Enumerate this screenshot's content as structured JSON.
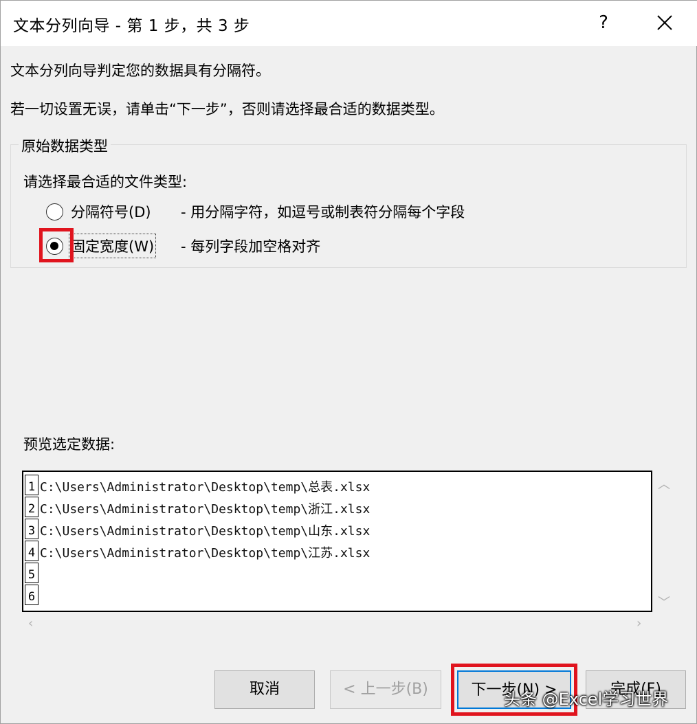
{
  "window": {
    "title": "文本分列向导 - 第 1 步，共 3 步",
    "help_label": "?"
  },
  "instructions": {
    "line1": "文本分列向导判定您的数据具有分隔符。",
    "line2": "若一切设置无误，请单击“下一步”，否则请选择最合适的数据类型。"
  },
  "original_type_group": {
    "title": "原始数据类型",
    "prompt": "请选择最合适的文件类型:",
    "options": [
      {
        "label": "分隔符号(D)",
        "description": "- 用分隔字符，如逗号或制表符分隔每个字段",
        "selected": false
      },
      {
        "label": "固定宽度(W)",
        "description": "- 每列字段加空格对齐",
        "selected": true
      }
    ]
  },
  "preview": {
    "label": "预览选定数据:",
    "rows": [
      {
        "num": "1",
        "text": "C:\\Users\\Administrator\\Desktop\\temp\\总表.xlsx"
      },
      {
        "num": "2",
        "text": "C:\\Users\\Administrator\\Desktop\\temp\\浙江.xlsx"
      },
      {
        "num": "3",
        "text": "C:\\Users\\Administrator\\Desktop\\temp\\山东.xlsx"
      },
      {
        "num": "4",
        "text": "C:\\Users\\Administrator\\Desktop\\temp\\江苏.xlsx"
      },
      {
        "num": "5",
        "text": ""
      },
      {
        "num": "6",
        "text": ""
      }
    ]
  },
  "buttons": {
    "cancel": "取消",
    "back": "< 上一步(B)",
    "next": "下一步(N) >",
    "finish": "完成(F)"
  },
  "watermark": "头条 @Excel学习世界",
  "highlight_color": "#e0141e"
}
